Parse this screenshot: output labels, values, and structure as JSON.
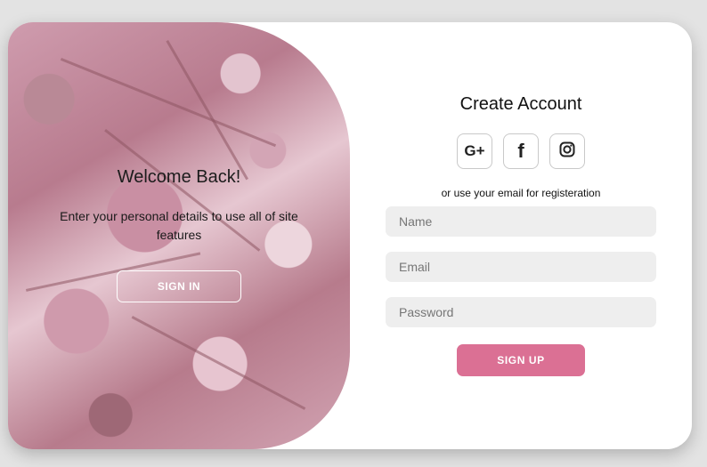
{
  "welcome": {
    "title": "Welcome Back!",
    "text": "Enter your personal details to use all of site features",
    "signin_label": "SIGN IN"
  },
  "signup": {
    "title": "Create Account",
    "socials": [
      {
        "label": "G+",
        "icon": "google-plus-icon"
      },
      {
        "label": "f",
        "icon": "facebook-icon"
      },
      {
        "label": "",
        "icon": "instagram-icon"
      }
    ],
    "subtitle": "or use your email for registeration",
    "fields": {
      "name_placeholder": "Name",
      "email_placeholder": "Email",
      "password_placeholder": "Password"
    },
    "button_label": "SIGN UP"
  },
  "colors": {
    "accent": "#db7094",
    "field_bg": "#eeeeee",
    "page_bg": "#e3e3e3"
  }
}
